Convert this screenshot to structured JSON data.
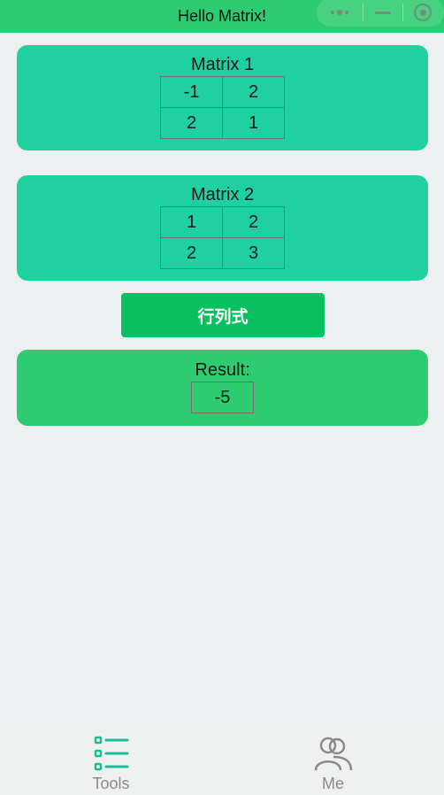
{
  "header": {
    "title": "Hello Matrix!"
  },
  "matrix1": {
    "title": "Matrix 1",
    "rows": [
      [
        "-1",
        "2"
      ],
      [
        "2",
        "1"
      ]
    ]
  },
  "matrix2": {
    "title": "Matrix 2",
    "rows": [
      [
        "1",
        "2"
      ],
      [
        "2",
        "3"
      ]
    ]
  },
  "action": {
    "label": "行列式"
  },
  "result": {
    "title": "Result:",
    "value": "-5"
  },
  "tabbar": {
    "items": [
      {
        "label": "Tools",
        "icon": "list-icon",
        "active": true
      },
      {
        "label": "Me",
        "icon": "users-icon",
        "active": false
      }
    ]
  },
  "colors": {
    "header": "#2ecc71",
    "matrix_card": "#1fd1a1",
    "result_card": "#2ecc71",
    "button": "#07c160",
    "tab_active_icon": "#1abc9c",
    "tab_inactive_icon": "#8a8a8a"
  }
}
